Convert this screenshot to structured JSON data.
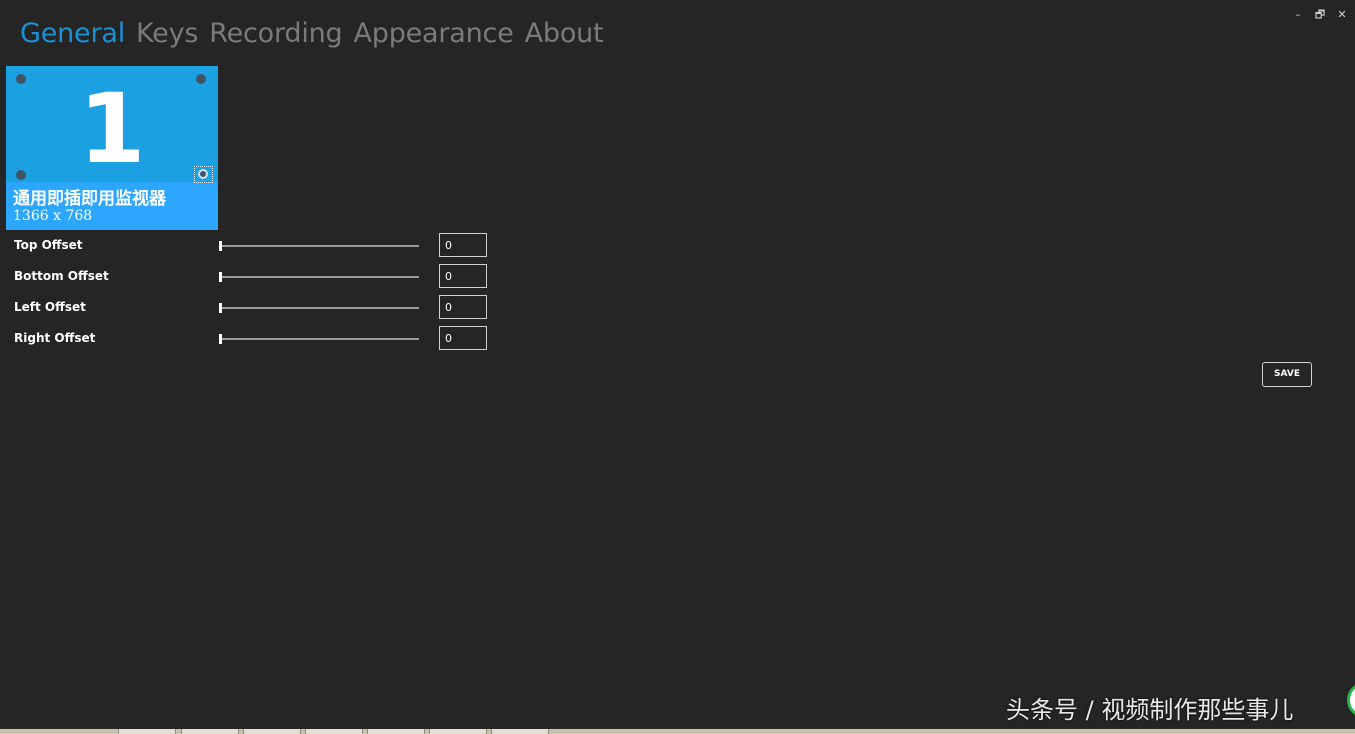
{
  "window": {
    "controls": {
      "minimize": "–",
      "restore": "🗗",
      "close": "✕"
    }
  },
  "tabs": [
    {
      "label": "General",
      "active": true
    },
    {
      "label": "Keys",
      "active": false
    },
    {
      "label": "Recording",
      "active": false
    },
    {
      "label": "Appearance",
      "active": false
    },
    {
      "label": "About",
      "active": false
    }
  ],
  "monitor": {
    "number": "1",
    "name": "通用即插即用监视器",
    "resolution": "1366 x 768",
    "tile_color": "#1ba1e2"
  },
  "offsets": [
    {
      "label": "Top Offset",
      "value": "0"
    },
    {
      "label": "Bottom Offset",
      "value": "0"
    },
    {
      "label": "Left Offset",
      "value": "0"
    },
    {
      "label": "Right Offset",
      "value": "0"
    }
  ],
  "save_label": "SAVE",
  "watermark": "头条号 / 视频制作那些事儿",
  "colors": {
    "background": "#252525",
    "accent": "#1a90d4",
    "tab_inactive": "#7a7a7a"
  }
}
